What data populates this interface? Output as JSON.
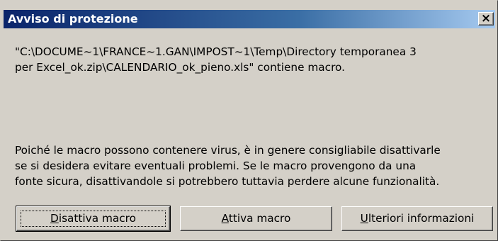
{
  "dialog": {
    "title": "Avviso di protezione",
    "close_label": "×",
    "message_line1": "\"C:\\DOCUME~1\\FRANCE~1.GAN\\IMPOST~1\\Temp\\Directory temporanea 3",
    "message_line2": "per Excel_ok.zip\\CALENDARIO_ok_pieno.xls\" contiene macro.",
    "warning_line1": "Poiché le macro possono contenere virus, è in genere consigliabile disattivarle",
    "warning_line2": "se si desidera evitare eventuali problemi. Se le macro provengono da una",
    "warning_line3": "fonte sicura, disattivandole si potrebbero tuttavia perdere alcune funzionalità."
  },
  "buttons": {
    "disable": {
      "accel": "D",
      "rest": "isattiva macro"
    },
    "enable": {
      "accel": "A",
      "rest": "ttiva macro"
    },
    "more_info": {
      "accel": "U",
      "rest": "lteriori informazioni"
    }
  },
  "colors": {
    "titlebar_start": "#0a246a",
    "titlebar_end": "#a6caf0",
    "face": "#d4d0c8"
  }
}
